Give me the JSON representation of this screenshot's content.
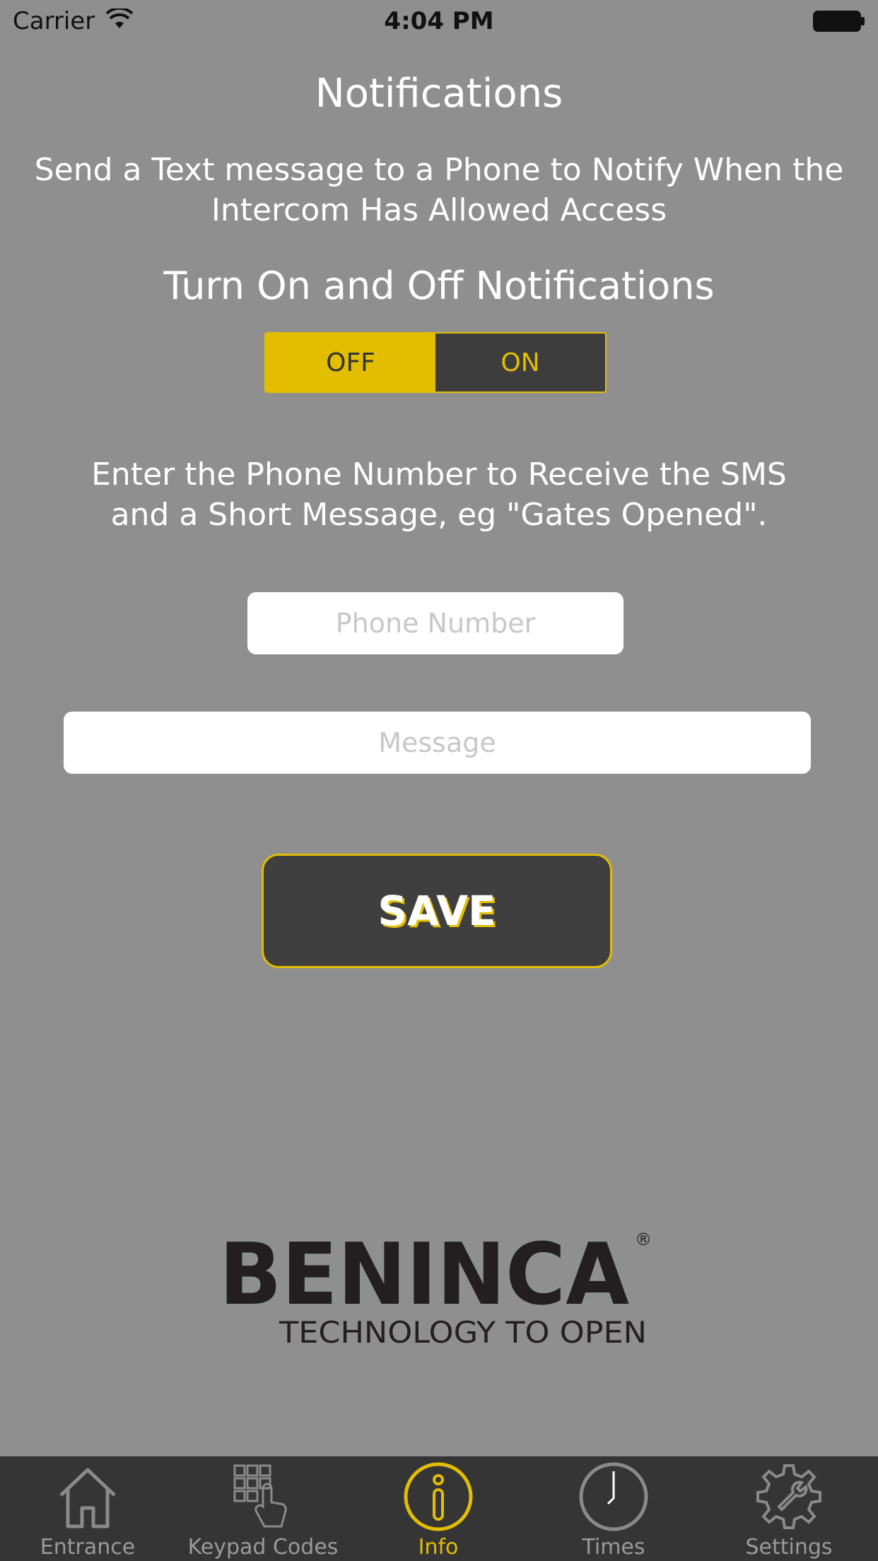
{
  "status_bar": {
    "carrier": "Carrier",
    "time": "4:04 PM"
  },
  "page": {
    "title": "Notifications",
    "intro": "Send a Text message to a Phone to Notify When the Intercom Has Allowed Access",
    "toggle_heading": "Turn On and Off Notifications",
    "toggle": {
      "off_label": "OFF",
      "on_label": "ON",
      "selected": "OFF"
    },
    "instructions": "Enter the Phone Number to Receive the SMS and a Short Message, eg \"Gates Opened\".",
    "phone_placeholder": "Phone Number",
    "message_placeholder": "Message",
    "save_label": "SAVE"
  },
  "logo": {
    "brand": "BENINCA",
    "tagline": "TECHNOLOGY TO OPEN",
    "mark": "®"
  },
  "tab_bar": {
    "items": [
      {
        "label": "Entrance",
        "icon": "house-icon"
      },
      {
        "label": "Keypad Codes",
        "icon": "keypad-icon"
      },
      {
        "label": "Info",
        "icon": "info-icon",
        "active": true
      },
      {
        "label": "Times",
        "icon": "clock-icon"
      },
      {
        "label": "Settings",
        "icon": "gear-wrench-icon"
      }
    ]
  },
  "colors": {
    "accent": "#e2bd00",
    "background": "#8f8f8f",
    "dark": "#3d3d3d"
  }
}
